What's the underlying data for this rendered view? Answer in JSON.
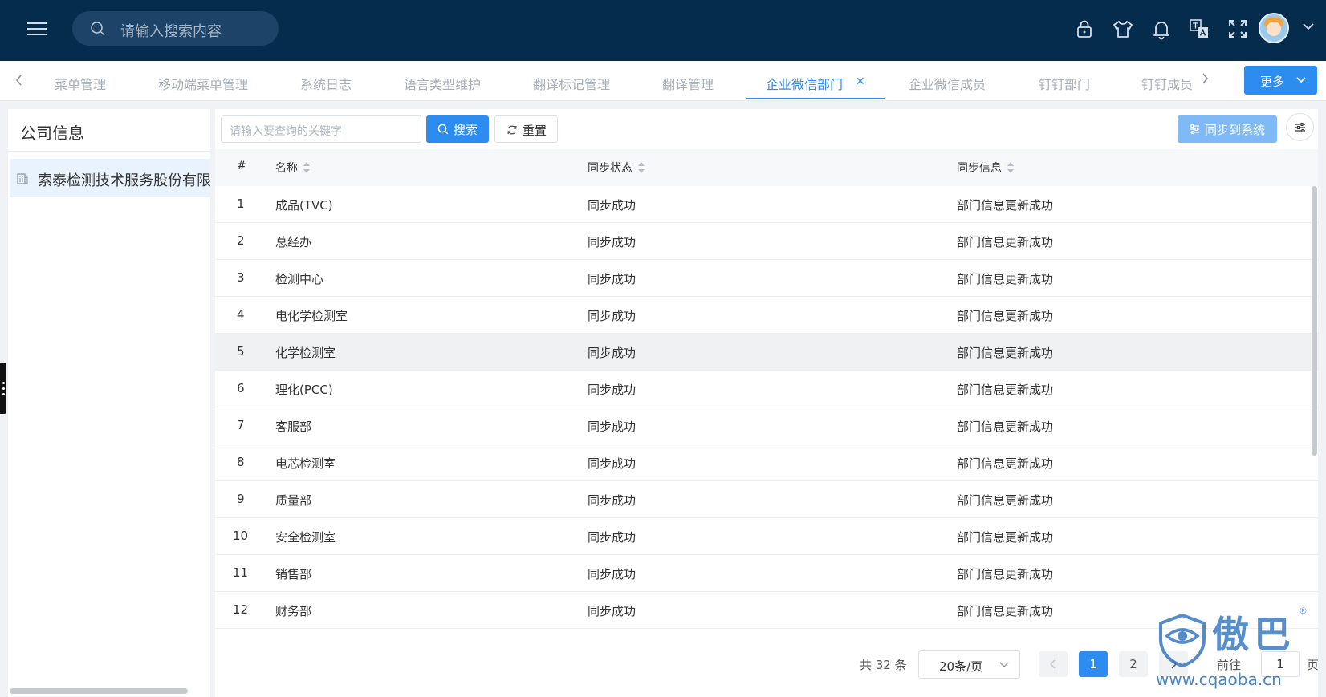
{
  "header": {
    "search_placeholder": "请输入搜索内容",
    "icons": [
      "menu-icon",
      "search-icon",
      "lock-icon",
      "shirt-icon",
      "bell-icon",
      "translate-icon",
      "fullscreen-icon",
      "avatar",
      "chevron-down-icon"
    ],
    "background": "#062c4d"
  },
  "tabs": {
    "items": [
      "菜单管理",
      "移动端菜单管理",
      "系统日志",
      "语言类型维护",
      "翻译标记管理",
      "翻译管理",
      "企业微信部门",
      "企业微信成员",
      "钉钉部门",
      "钉钉成员"
    ],
    "active": "企业微信部门",
    "more_label": "更多",
    "accent": "#2d8cf0"
  },
  "left": {
    "title": "公司信息",
    "node_label": "索泰检测技术服务股份有限公司"
  },
  "toolbar": {
    "keyword_placeholder": "请输入要查询的关键字",
    "search_label": "搜索",
    "reset_label": "重置",
    "sync_label": "同步到系统"
  },
  "table": {
    "headers": [
      "#",
      "名称",
      "同步状态",
      "同步信息"
    ],
    "rows": [
      {
        "no": "1",
        "name": "成品(TVC)",
        "status": "同步成功",
        "info": "部门信息更新成功"
      },
      {
        "no": "2",
        "name": "总经办",
        "status": "同步成功",
        "info": "部门信息更新成功"
      },
      {
        "no": "3",
        "name": "检测中心",
        "status": "同步成功",
        "info": "部门信息更新成功"
      },
      {
        "no": "4",
        "name": "电化学检测室",
        "status": "同步成功",
        "info": "部门信息更新成功"
      },
      {
        "no": "5",
        "name": "化学检测室",
        "status": "同步成功",
        "info": "部门信息更新成功"
      },
      {
        "no": "6",
        "name": "理化(PCC)",
        "status": "同步成功",
        "info": "部门信息更新成功"
      },
      {
        "no": "7",
        "name": "客服部",
        "status": "同步成功",
        "info": "部门信息更新成功"
      },
      {
        "no": "8",
        "name": "电芯检测室",
        "status": "同步成功",
        "info": "部门信息更新成功"
      },
      {
        "no": "9",
        "name": "质量部",
        "status": "同步成功",
        "info": "部门信息更新成功"
      },
      {
        "no": "10",
        "name": "安全检测室",
        "status": "同步成功",
        "info": "部门信息更新成功"
      },
      {
        "no": "11",
        "name": "销售部",
        "status": "同步成功",
        "info": "部门信息更新成功"
      },
      {
        "no": "12",
        "name": "财务部",
        "status": "同步成功",
        "info": "部门信息更新成功"
      }
    ],
    "highlighted_row": "5"
  },
  "pagination": {
    "total_label": "共 32 条",
    "page_size": "20条/页",
    "pages": [
      "1",
      "2"
    ],
    "current": "1",
    "goto_prefix": "前往",
    "goto_value": "1",
    "goto_suffix": "页"
  },
  "watermark": {
    "text": "傲巴",
    "url": "www.cqaoba.cn",
    "reg": "®"
  }
}
